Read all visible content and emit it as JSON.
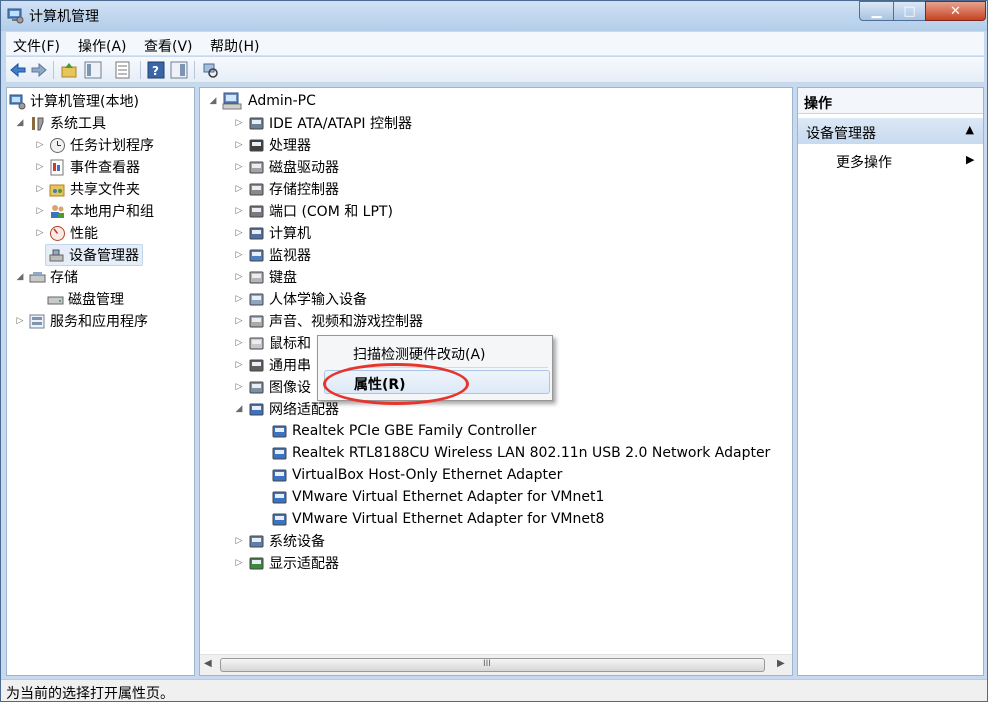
{
  "window": {
    "title": "计算机管理"
  },
  "menu": [
    "文件(F)",
    "操作(A)",
    "查看(V)",
    "帮助(H)"
  ],
  "left_tree": {
    "root": "计算机管理(本地)",
    "system_tools": "系统工具",
    "task_scheduler": "任务计划程序",
    "event_viewer": "事件查看器",
    "shared_folders": "共享文件夹",
    "local_users": "本地用户和组",
    "performance": "性能",
    "device_manager": "设备管理器",
    "storage": "存储",
    "disk_management": "磁盘管理",
    "services": "服务和应用程序"
  },
  "devices": {
    "root": "Admin-PC",
    "items": [
      "IDE ATA/ATAPI 控制器",
      "处理器",
      "磁盘驱动器",
      "存储控制器",
      "端口 (COM 和 LPT)",
      "计算机",
      "监视器",
      "键盘",
      "人体学输入设备",
      "声音、视频和游戏控制器",
      "鼠标和",
      "通用串",
      "图像设",
      "网络适配器"
    ],
    "network": [
      "Realtek PCIe GBE Family Controller",
      "Realtek RTL8188CU Wireless LAN 802.11n USB 2.0 Network Adapter",
      "VirtualBox Host-Only Ethernet Adapter",
      "VMware Virtual Ethernet Adapter for VMnet1",
      "VMware Virtual Ethernet Adapter for VMnet8"
    ],
    "after": [
      "系统设备",
      "显示适配器"
    ]
  },
  "context_menu": {
    "scan": "扫描检测硬件改动(A)",
    "properties": "属性(R)"
  },
  "actions": {
    "header": "操作",
    "group": "设备管理器",
    "more": "更多操作"
  },
  "status": "为当前的选择打开属性页。",
  "scroll_grip": "III"
}
